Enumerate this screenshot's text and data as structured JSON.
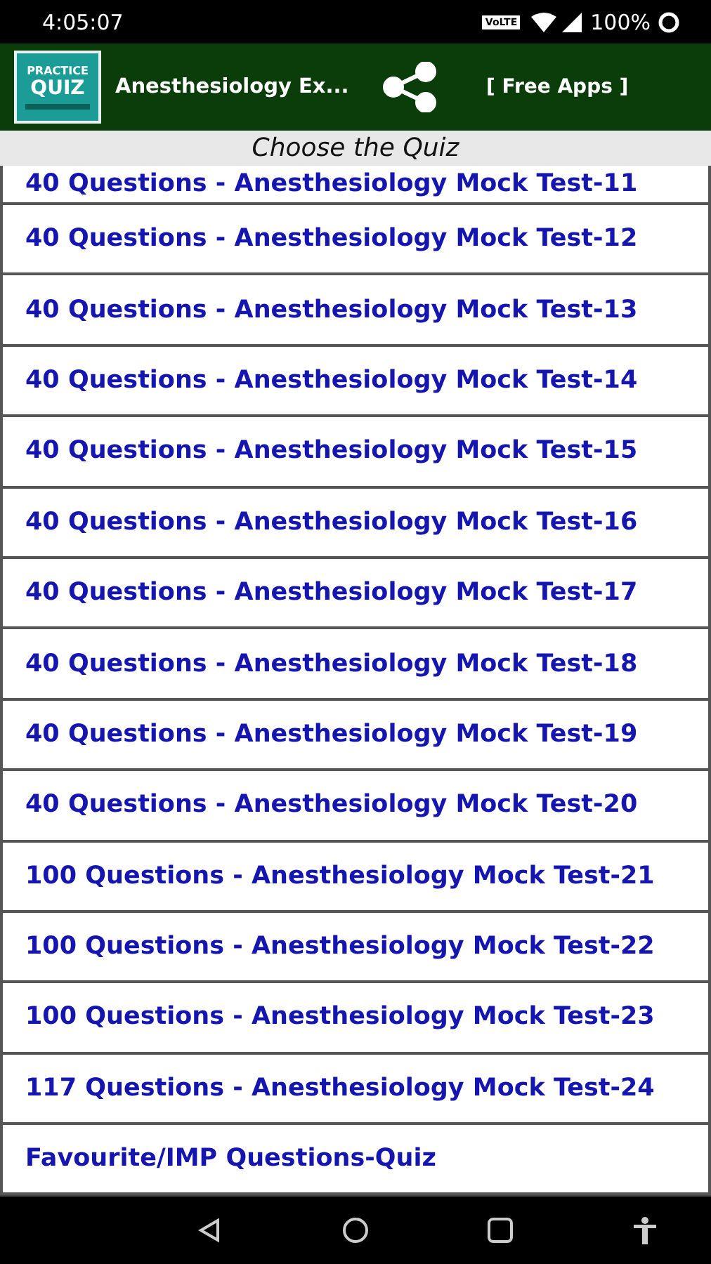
{
  "status_bar": {
    "time": "4:05:07",
    "network_badge": "VoLTE",
    "battery": "100%"
  },
  "app_bar": {
    "logo": {
      "line_1": "PRACTICE",
      "line_2": "QUIZ"
    },
    "title": "Anesthesiology Ex...",
    "free_apps": "[ Free Apps ]"
  },
  "header": "Choose the Quiz",
  "quizzes": [
    {
      "label": "40 Questions - Anesthesiology Mock Test-11"
    },
    {
      "label": "40 Questions - Anesthesiology Mock Test-12"
    },
    {
      "label": "40 Questions - Anesthesiology Mock Test-13"
    },
    {
      "label": "40 Questions - Anesthesiology Mock Test-14"
    },
    {
      "label": "40 Questions - Anesthesiology Mock Test-15"
    },
    {
      "label": "40 Questions - Anesthesiology Mock Test-16"
    },
    {
      "label": "40 Questions - Anesthesiology Mock Test-17"
    },
    {
      "label": "40 Questions - Anesthesiology Mock Test-18"
    },
    {
      "label": "40 Questions - Anesthesiology Mock Test-19"
    },
    {
      "label": "40 Questions - Anesthesiology Mock Test-20"
    },
    {
      "label": "100 Questions - Anesthesiology Mock Test-21"
    },
    {
      "label": "100 Questions - Anesthesiology Mock Test-22"
    },
    {
      "label": "100 Questions - Anesthesiology Mock Test-23"
    },
    {
      "label": "117 Questions - Anesthesiology Mock Test-24"
    },
    {
      "label": "Favourite/IMP Questions-Quiz"
    }
  ]
}
